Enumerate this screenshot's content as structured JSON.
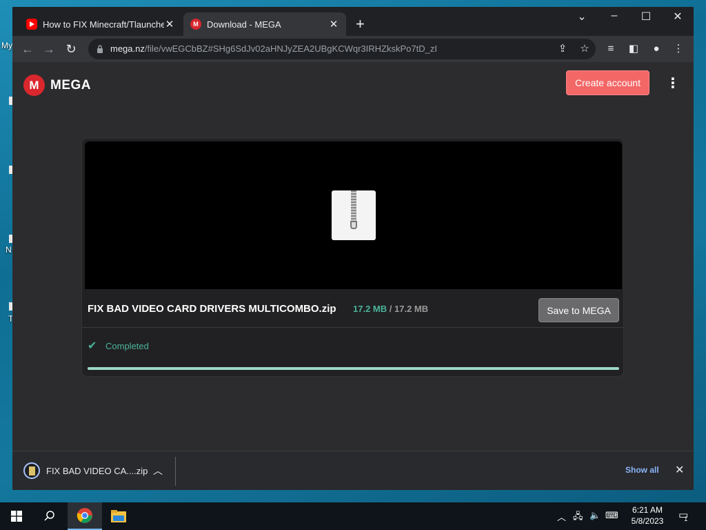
{
  "desktop": {
    "labels": [
      "My",
      "N",
      "T"
    ]
  },
  "browser": {
    "tabs": [
      {
        "title": "How to FIX Minecraft/Tlauncher",
        "favicon": "youtube-icon",
        "active": false
      },
      {
        "title": "Download - MEGA",
        "favicon": "mega-icon",
        "active": true
      }
    ],
    "address": {
      "host": "mega.nz",
      "path": "/file/vwEGCbBZ#SHg6SdJv02aHNJyZEA2UBgKCWqr3IRHZkskPo7tD_zI"
    }
  },
  "page": {
    "logo_letter": "M",
    "logo_text": "MEGA",
    "create_account_label": "Create account",
    "file": {
      "name": "FIX BAD VIDEO CARD DRIVERS MULTICOMBO.zip",
      "downloaded": "17.2 MB",
      "separator": "/",
      "total": "17.2 MB",
      "progress_percent": 100
    },
    "save_label": "Save to MEGA",
    "status_text": "Completed"
  },
  "download_shelf": {
    "item_name": "FIX BAD VIDEO CA....zip",
    "show_all_label": "Show all"
  },
  "taskbar": {
    "time": "6:21 AM",
    "date": "5/8/2023",
    "notification_count": "1"
  },
  "colors": {
    "mega_red": "#d9272e",
    "create_account_bg": "#f46767",
    "completed_green": "#4ab39a",
    "progress_fill": "#9ed9c6"
  }
}
